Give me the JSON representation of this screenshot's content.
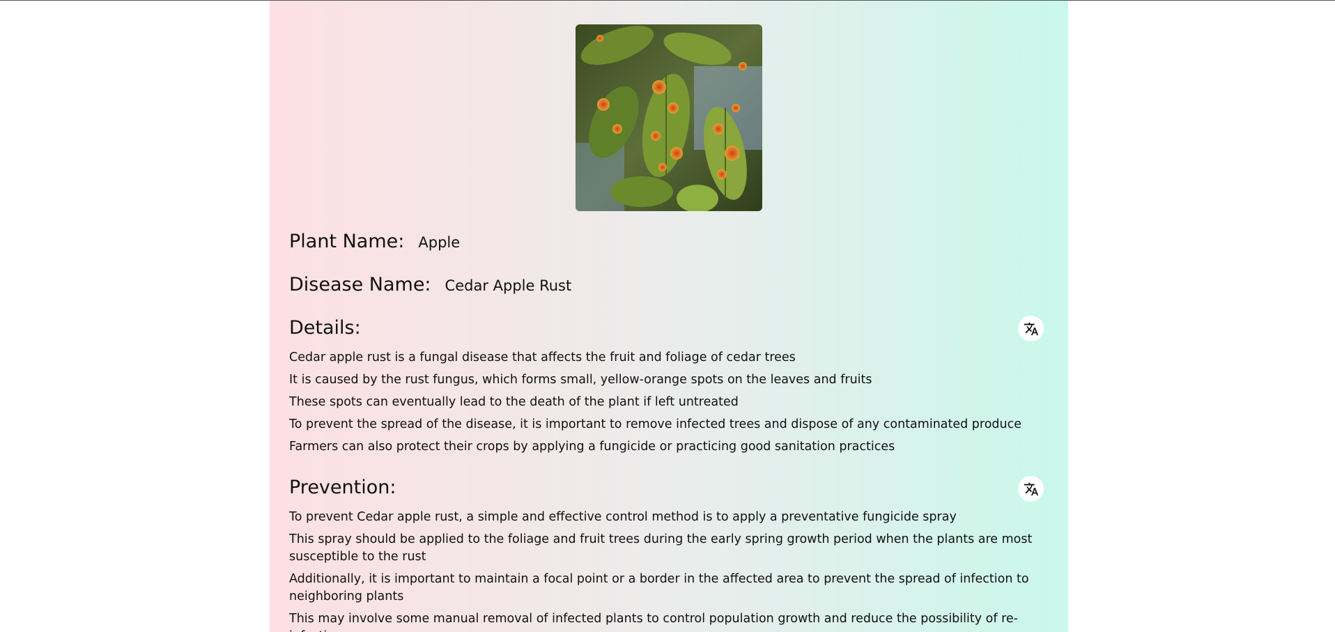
{
  "plant": {
    "label": "Plant Name:",
    "value": "Apple"
  },
  "disease": {
    "label": "Disease Name:",
    "value": "Cedar Apple Rust"
  },
  "details": {
    "title": "Details:",
    "translate_icon": "translate-icon",
    "lines": [
      "Cedar apple rust is a fungal disease that affects the fruit and foliage of cedar trees",
      "It is caused by the rust fungus, which forms small, yellow-orange spots on the leaves and fruits",
      "These spots can eventually lead to the death of the plant if left untreated",
      "To prevent the spread of the disease, it is important to remove infected trees and dispose of any contaminated produce",
      "Farmers can also protect their crops by applying a fungicide or practicing good sanitation practices"
    ]
  },
  "prevention": {
    "title": "Prevention:",
    "translate_icon": "translate-icon",
    "lines": [
      "To prevent Cedar apple rust, a simple and effective control method is to apply a preventative fungicide spray",
      "This spray should be applied to the foliage and fruit trees during the early spring growth period when the plants are most susceptible to the rust",
      "Additionally, it is important to maintain a focal point or a border in the affected area to prevent the spread of infection to neighboring plants",
      "This may involve some manual removal of infected plants to control population growth and reduce the possibility of re-infection"
    ]
  },
  "colors": {
    "gradient_left": "#fde0e3",
    "gradient_mid": "#ececec",
    "gradient_right": "#c9f8ea",
    "text": "#111111"
  }
}
